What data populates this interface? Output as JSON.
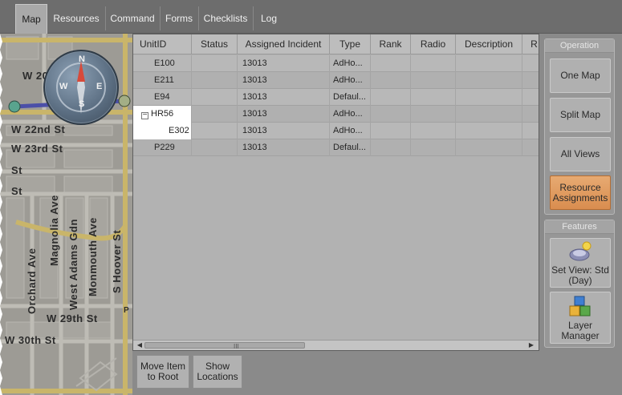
{
  "tabs": [
    {
      "label": "Map",
      "active": true
    },
    {
      "label": "Resources"
    },
    {
      "label": "Command"
    },
    {
      "label": "Forms"
    },
    {
      "label": "Checklists"
    },
    {
      "label": "Log"
    }
  ],
  "map": {
    "streets": [
      "W 20",
      "W 22nd St",
      "W 23rd St",
      "St",
      "St",
      "Magnolia Ave",
      "West Adams Gdn",
      "Monmouth Ave",
      "S Hoover St",
      "Orchard Ave",
      "W 29th St",
      "W 30th St",
      "P"
    ],
    "compass": {
      "n": "N",
      "e": "E",
      "s": "S",
      "w": "W"
    }
  },
  "grid": {
    "columns": [
      "UnitID",
      "Status",
      "Assigned Incident",
      "Type",
      "Rank",
      "Radio",
      "Description",
      "R"
    ],
    "rows": [
      {
        "unit": "E100",
        "status": "",
        "incident": "13013",
        "type": "AdHo...",
        "rank": "",
        "radio": "",
        "description": ""
      },
      {
        "unit": "E211",
        "status": "",
        "incident": "13013",
        "type": "AdHo...",
        "rank": "",
        "radio": "",
        "description": ""
      },
      {
        "unit": "E94",
        "status": "",
        "incident": "13013",
        "type": "Defaul...",
        "rank": "",
        "radio": "",
        "description": ""
      },
      {
        "unit": "HR56",
        "status": "",
        "incident": "13013",
        "type": "AdHo...",
        "rank": "",
        "radio": "",
        "description": "",
        "expander": "−"
      },
      {
        "unit": "E302",
        "status": "",
        "incident": "13013",
        "type": "AdHo...",
        "rank": "",
        "radio": "",
        "description": ""
      },
      {
        "unit": "P229",
        "status": "",
        "incident": "13013",
        "type": "Defaul...",
        "rank": "",
        "radio": "",
        "description": ""
      }
    ],
    "scroll_grip": "III"
  },
  "bottom_buttons": [
    "Move Item to Root",
    "Show Locations"
  ],
  "operation": {
    "title": "Operation",
    "buttons": [
      "One Map",
      "Split Map",
      "All Views",
      "Resource Assignments"
    ]
  },
  "features": {
    "title": "Features",
    "buttons": [
      "Set View: Std (Day)",
      "Layer Manager"
    ]
  }
}
